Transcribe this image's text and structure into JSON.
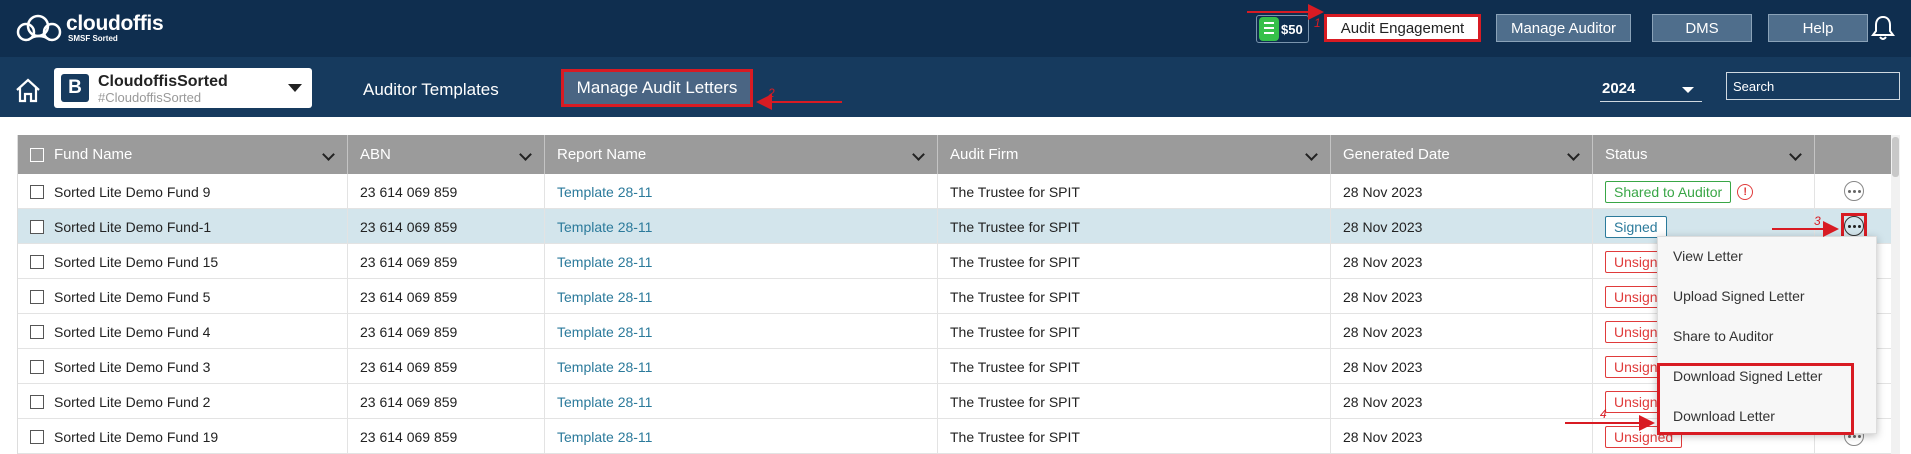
{
  "header": {
    "logo_name": "cloudoffis",
    "logo_tagline": "SMSF Sorted",
    "credit": "$50",
    "buttons": [
      {
        "label": "Audit Engagement",
        "active": true
      },
      {
        "label": "Manage Auditor",
        "active": false
      },
      {
        "label": "DMS",
        "active": false
      },
      {
        "label": "Help",
        "active": false
      }
    ],
    "icons": {
      "logo": "cloud-logo-icon",
      "credit": "credit-coin-icon",
      "notifications": "bell-icon",
      "home": "home-icon"
    }
  },
  "subheader": {
    "company_initial": "B",
    "company_name": "CloudoffisSorted",
    "company_handle": "#CloudoffisSorted",
    "nav": [
      {
        "label": "Auditor Templates",
        "active": false
      },
      {
        "label": "Manage Audit Letters",
        "active": true
      }
    ],
    "year": "2024",
    "search_placeholder": "Search"
  },
  "table": {
    "columns": [
      "Fund Name",
      "ABN",
      "Report Name",
      "Audit Firm",
      "Generated Date",
      "Status"
    ],
    "rows": [
      {
        "fund": "Sorted Lite Demo Fund 9",
        "abn": "23 614 069 859",
        "report": "Template 28-11",
        "firm": "The Trustee for SPIT",
        "date": "28 Nov 2023",
        "status": "Shared to Auditor",
        "status_type": "shared",
        "warning": "!"
      },
      {
        "fund": "Sorted Lite Demo Fund-1",
        "abn": "23 614 069 859",
        "report": "Template 28-11",
        "firm": "The Trustee for SPIT",
        "date": "28 Nov 2023",
        "status": "Signed",
        "status_type": "signed",
        "selected": true
      },
      {
        "fund": "Sorted Lite Demo Fund 15",
        "abn": "23 614 069 859",
        "report": "Template 28-11",
        "firm": "The Trustee for SPIT",
        "date": "28 Nov 2023",
        "status": "Unsigned",
        "status_type": "unsigned"
      },
      {
        "fund": "Sorted Lite Demo Fund 5",
        "abn": "23 614 069 859",
        "report": "Template 28-11",
        "firm": "The Trustee for SPIT",
        "date": "28 Nov 2023",
        "status": "Unsigned",
        "status_type": "unsigned"
      },
      {
        "fund": "Sorted Lite Demo Fund 4",
        "abn": "23 614 069 859",
        "report": "Template 28-11",
        "firm": "The Trustee for SPIT",
        "date": "28 Nov 2023",
        "status": "Unsigned",
        "status_type": "unsigned"
      },
      {
        "fund": "Sorted Lite Demo Fund 3",
        "abn": "23 614 069 859",
        "report": "Template 28-11",
        "firm": "The Trustee for SPIT",
        "date": "28 Nov 2023",
        "status": "Unsigned",
        "status_type": "unsigned"
      },
      {
        "fund": "Sorted Lite Demo Fund 2",
        "abn": "23 614 069 859",
        "report": "Template 28-11",
        "firm": "The Trustee for SPIT",
        "date": "28 Nov 2023",
        "status": "Unsigned",
        "status_type": "unsigned"
      },
      {
        "fund": "Sorted Lite Demo Fund 19",
        "abn": "23 614 069 859",
        "report": "Template 28-11",
        "firm": "The Trustee for SPIT",
        "date": "28 Nov 2023",
        "status": "Unsigned",
        "status_type": "unsigned"
      }
    ]
  },
  "action_menu": {
    "items": [
      "View Letter",
      "Upload Signed Letter",
      "Share to Auditor",
      "Download Signed Letter",
      "Download Letter"
    ]
  },
  "annotations": [
    "1",
    "2",
    "3",
    "4"
  ],
  "colors": {
    "topbar": "#0f2e4f",
    "subbar": "#163a5e",
    "highlight": "#d81b23",
    "link": "#2b7a9b",
    "shared": "#39a646",
    "unsigned": "#e03b3b"
  }
}
